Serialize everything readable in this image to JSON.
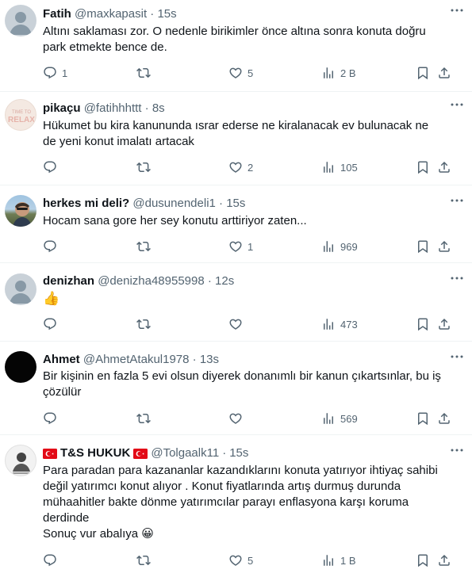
{
  "colors": {
    "text": "#0f1419",
    "muted": "#536471",
    "divider": "#eff3f4",
    "flag": "#e30a17"
  },
  "tweets": [
    {
      "name": "Fatih",
      "handle": "@maxkapasit",
      "dot": "·",
      "time": "15s",
      "lines": [
        "Altını saklaması zor. O nedenle birikimler önce altına sonra konuta doğru",
        "park etmekte bence de."
      ],
      "replies": "1",
      "retweets": "",
      "likes": "5",
      "views": "2 B",
      "avatar": "default-avatar"
    },
    {
      "name": "pikaçu",
      "handle": "@fatihhhttt",
      "dot": "·",
      "time": "8s",
      "lines": [
        "Hükumet bu kira kanununda ısrar ederse ne kiralanacak ev bulunacak ne",
        "de yeni konut imalatı artacak"
      ],
      "replies": "",
      "retweets": "",
      "likes": "2",
      "views": "105",
      "avatar": "time-to-relax-avatar",
      "avatar_text": [
        "TIME TO",
        "RELAX"
      ]
    },
    {
      "name": "herkes mi deli?",
      "handle": "@dusunendeli1",
      "dot": "·",
      "time": "15s",
      "lines": [
        "Hocam sana gore her sey konutu arttiriyor zaten..."
      ],
      "replies": "",
      "retweets": "",
      "likes": "1",
      "views": "969",
      "avatar": "photo-avatar"
    },
    {
      "name": "denizhan",
      "handle": "@denizha48955998",
      "dot": "·",
      "time": "12s",
      "lines": [
        "👍"
      ],
      "replies": "",
      "retweets": "",
      "likes": "",
      "views": "473",
      "avatar": "default-avatar"
    },
    {
      "name": "Ahmet",
      "handle": "@AhmetAtakul1978",
      "dot": "·",
      "time": "13s",
      "lines": [
        "Bir kişinin en fazla 5 evi olsun diyerek donanımlı bir kanun çıkartsınlar, bu iş",
        "çözülür"
      ],
      "replies": "",
      "retweets": "",
      "likes": "",
      "views": "569",
      "avatar": "black-avatar"
    },
    {
      "name": "T&S HUKUK",
      "handle": "@Tolgaalk11",
      "dot": "·",
      "time": "15s",
      "lines": [
        "Para paradan para kazananlar kazandıklarını konuta yatırıyor ihtiyaç sahibi",
        "değil yatırımcı konut alıyor . Konut fiyatlarında artış durmuş durunda",
        "mühaahitler bakte dönme yatırımcılar parayı enflasyona karşı koruma",
        "derdinde",
        "Sonuç vur abalıya 😀"
      ],
      "replies": "",
      "retweets": "",
      "likes": "5",
      "views": "1 B",
      "avatar": "portrait-avatar"
    }
  ]
}
